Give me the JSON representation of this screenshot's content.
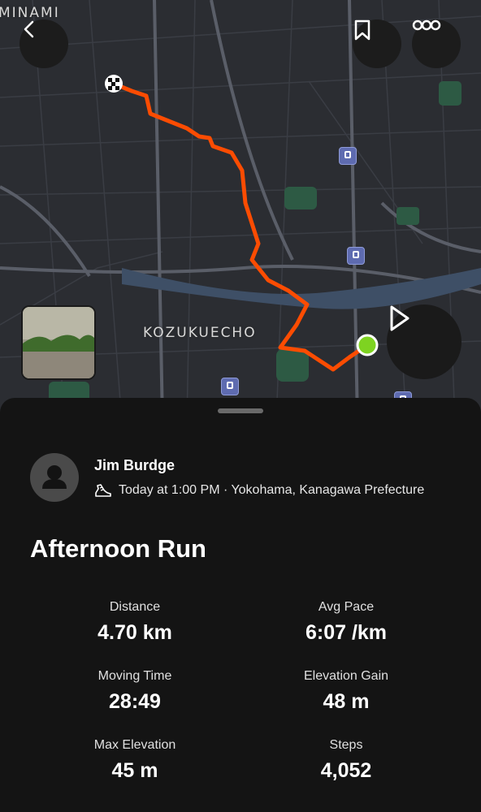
{
  "map": {
    "labels": {
      "minami": "MINAMI",
      "kozukuecho": "KOZUKUECHO"
    },
    "colors": {
      "route": "#fc4c02",
      "end_marker": "#7ed321",
      "park": "#2d5a44"
    }
  },
  "header": {
    "back_icon": "chevron-left-icon",
    "bookmark_icon": "bookmark-icon",
    "more_icon": "more-icon"
  },
  "athlete": {
    "name": "Jim Burdge",
    "meta": "Today at 1:00 PM · Yokohama, Kanagawa Prefecture"
  },
  "activity": {
    "title": "Afternoon Run"
  },
  "stats": [
    {
      "label": "Distance",
      "value": "4.70 km"
    },
    {
      "label": "Avg Pace",
      "value": "6:07 /km"
    },
    {
      "label": "Moving Time",
      "value": "28:49"
    },
    {
      "label": "Elevation Gain",
      "value": "48 m"
    },
    {
      "label": "Max Elevation",
      "value": "45 m"
    },
    {
      "label": "Steps",
      "value": "4,052"
    }
  ]
}
